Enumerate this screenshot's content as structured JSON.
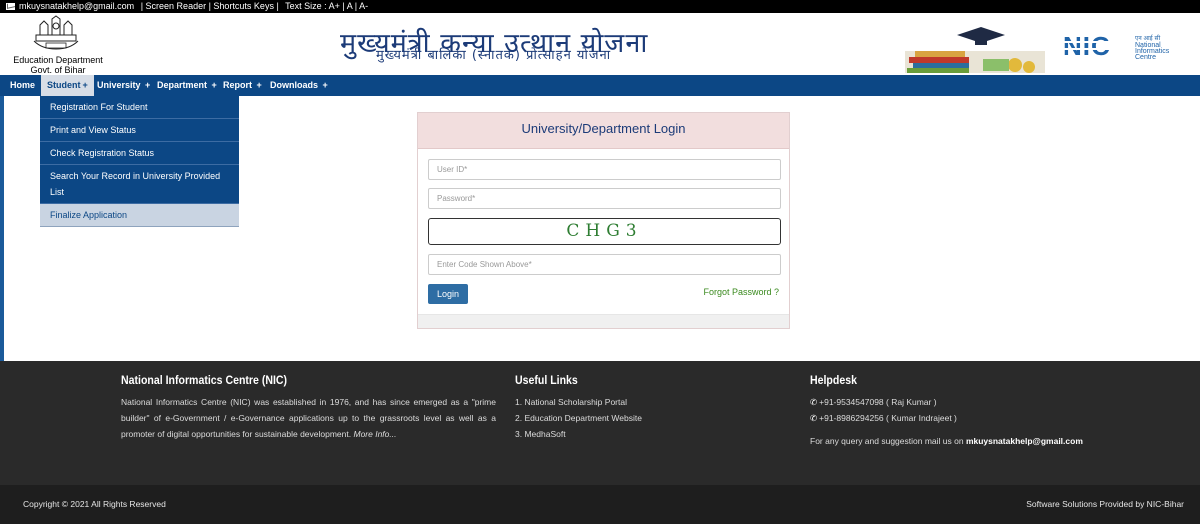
{
  "topbar": {
    "email": "mkuysnatakhelp@gmail.com",
    "links": "| Screen Reader | Shortcuts Keys |",
    "text_size": "Text Size : A+ | A  |  A-"
  },
  "header": {
    "dept_line1": "Education Department",
    "dept_line2": "Govt. of Bihar",
    "title": "मुख्यमंत्री कन्या उत्थान योजना",
    "subtitle": "मुख्यमंत्री बालिका (स्नातक) प्रोत्साहन योजना"
  },
  "nav": {
    "home": "Home",
    "student": "Student",
    "university": "University",
    "department": "Department",
    "report": "Report",
    "downloads": "Downloads",
    "plus": "+"
  },
  "dropdown": [
    "Registration For Student",
    "Print and View Status",
    "Check Registration Status",
    "Search Your Record in University Provided List",
    "Finalize Application"
  ],
  "login": {
    "title": "University/Department Login",
    "user_placeholder": "User ID*",
    "password_placeholder": "Password*",
    "captcha": "CHG3",
    "code_placeholder": "Enter Code Shown Above*",
    "button": "Login",
    "forgot": "Forgot Password ?"
  },
  "footer": {
    "nic_heading": "National Informatics Centre (NIC)",
    "nic_text": "National Informatics Centre (NIC) was established in 1976, and has since emerged as a \"prime builder\" of e-Government / e-Governance applications up to the grassroots level as well as a promoter of digital opportunities for sustainable development.",
    "more": "More Info...",
    "links_heading": "Useful Links",
    "links": [
      "1. National Scholarship Portal",
      "2. Education Department Website",
      "3. MedhaSoft"
    ],
    "help_heading": "Helpdesk",
    "phones": [
      "+91-9534547098 ( Raj Kumar )",
      "+91-8986294256 ( Kumar Indrajeet )"
    ],
    "query_text": "For any query and suggestion mail us on",
    "query_email": "mkuysnatakhelp@gmail.com",
    "copyright": "Copyright © 2021 All Rights Reserved",
    "provided": "Software Solutions Provided by NIC-Bihar"
  },
  "colors": {
    "navbar": "#0c4785",
    "title": "#1c3b78",
    "footer": "#2a2a2a",
    "login_head": "#f2dede"
  }
}
